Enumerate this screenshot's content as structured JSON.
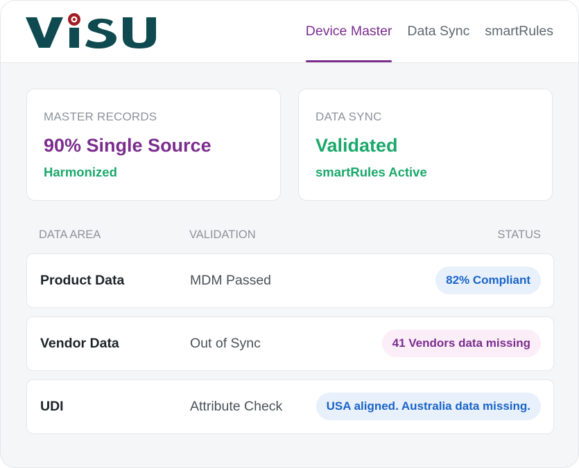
{
  "app": {
    "logo_text": "VISU"
  },
  "nav": {
    "tabs": [
      {
        "label": "Device Master",
        "active": true
      },
      {
        "label": "Data Sync",
        "active": false
      },
      {
        "label": "smartRules",
        "active": false
      }
    ]
  },
  "cards": [
    {
      "kicker": "MASTER RECORDS",
      "headline": "90% Single Source",
      "sub": "Harmonized"
    },
    {
      "kicker": "DATA SYNC",
      "headline": "Validated",
      "sub": "smartRules Active"
    }
  ],
  "table": {
    "headers": {
      "area": "DATA AREA",
      "validation": "VALIDATION",
      "status": "STATUS"
    },
    "rows": [
      {
        "area": "Product Data",
        "validation": "MDM Passed",
        "status": "82% Compliant"
      },
      {
        "area": "Vendor Data",
        "validation": "Out of Sync",
        "status": "41 Vendors data missing"
      },
      {
        "area": "UDI",
        "validation": "Attribute Check",
        "status": "USA aligned. Australia data missing."
      }
    ]
  },
  "colors": {
    "brand_teal": "#0e4a4f",
    "accent_purple": "#7b2d8e",
    "success_green": "#1aa86b",
    "badge_blue_text": "#1a64c8",
    "badge_blue_bg": "#e8f0fb",
    "badge_pink_bg": "#fbeef8"
  }
}
